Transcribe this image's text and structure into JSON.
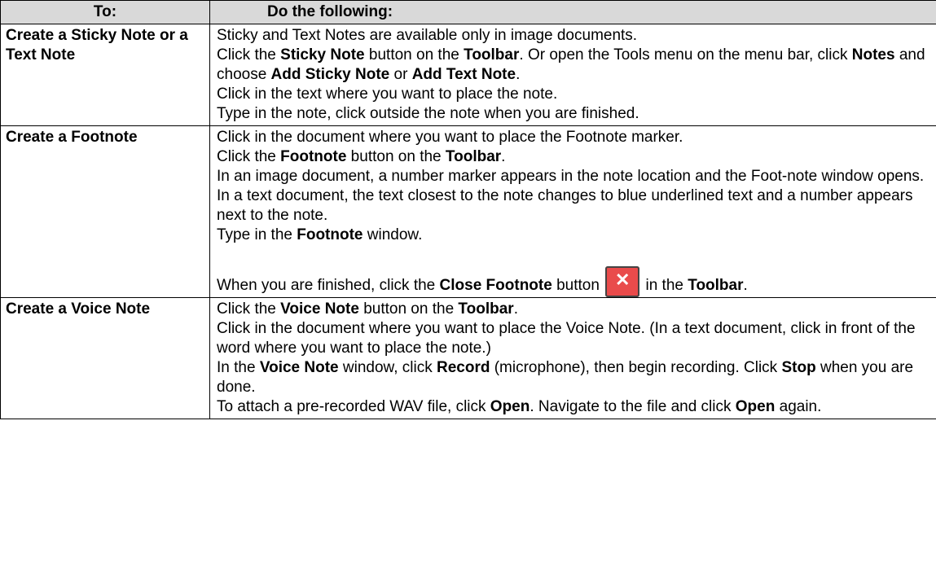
{
  "table": {
    "header": {
      "col1": "To:",
      "col2": "Do the following:"
    },
    "rows": [
      {
        "task": "Create a Sticky Note or a Text Note",
        "lines": [
          [
            {
              "t": "Sticky and Text Notes are available only in image documents."
            }
          ],
          [
            {
              "t": "Click the "
            },
            {
              "t": "Sticky Note",
              "b": true
            },
            {
              "t": " button on the "
            },
            {
              "t": "Toolbar",
              "b": true
            },
            {
              "t": ". Or open the Tools menu on the menu bar, click "
            },
            {
              "t": "Notes",
              "b": true
            },
            {
              "t": " and choose "
            },
            {
              "t": "Add Sticky Note",
              "b": true
            },
            {
              "t": " or "
            },
            {
              "t": "Add Text Note",
              "b": true
            },
            {
              "t": "."
            }
          ],
          [
            {
              "t": "Click in the text where you want to place the note."
            }
          ],
          [
            {
              "t": "Type in the note, click outside the note when you are finished."
            }
          ]
        ]
      },
      {
        "task": "Create a Footnote",
        "lines": [
          [
            {
              "t": "Click in the document where you want to place the Footnote marker."
            }
          ],
          [
            {
              "t": "Click the "
            },
            {
              "t": "Footnote",
              "b": true
            },
            {
              "t": " button on the "
            },
            {
              "t": "Toolbar",
              "b": true
            },
            {
              "t": "."
            }
          ],
          [
            {
              "t": "In an image document, a number marker appears in the note location and the Foot-note window opens."
            }
          ],
          [
            {
              "t": "In a text document, the text closest to the note changes to blue underlined text and a number appears next to the note."
            }
          ],
          [
            {
              "t": "Type in the "
            },
            {
              "t": "Footnote",
              "b": true
            },
            {
              "t": " window."
            }
          ]
        ],
        "close_line": {
          "before": "When you are finished, click the ",
          "bold": "Close Footnote",
          "middle": " button",
          "after_pre": " in the ",
          "after_bold": "Toolbar",
          "after_end": ".",
          "icon_glyph": "✕",
          "icon_color": "#e94b4b"
        }
      },
      {
        "task": "Create a Voice Note",
        "lines": [
          [
            {
              "t": "Click the "
            },
            {
              "t": "Voice Note",
              "b": true
            },
            {
              "t": " button on the "
            },
            {
              "t": "Toolbar",
              "b": true
            },
            {
              "t": "."
            }
          ],
          [
            {
              "t": "Click in the document where you want to place the Voice Note. (In a text document, click in front of the word where you want to place the note.)"
            }
          ],
          [
            {
              "t": "In the "
            },
            {
              "t": "Voice Note",
              "b": true
            },
            {
              "t": " window, click "
            },
            {
              "t": "Record",
              "b": true
            },
            {
              "t": " (microphone), then begin recording. Click "
            },
            {
              "t": "Stop",
              "b": true
            },
            {
              "t": " when you are done."
            }
          ],
          [
            {
              "t": "To attach a pre-recorded WAV file, click "
            },
            {
              "t": "Open",
              "b": true
            },
            {
              "t": ". Navigate to the file and click "
            },
            {
              "t": "Open",
              "b": true
            },
            {
              "t": " again."
            }
          ]
        ]
      }
    ]
  }
}
